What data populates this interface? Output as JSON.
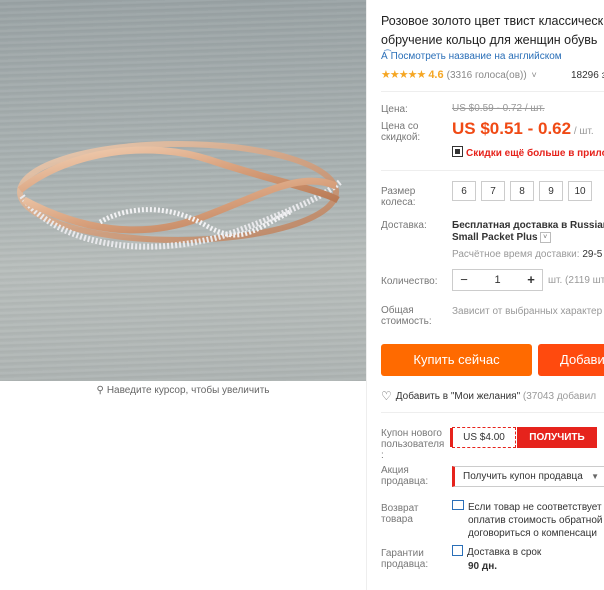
{
  "image": {
    "zoom_hint": "Наведите курсор, чтобы увеличить"
  },
  "product": {
    "title_line1": "Розовое золото цвет твист классическ",
    "title_line2": "обручение кольцо для женщин обувь",
    "translate_link": "Посмотреть название на английском",
    "stars": "★★★★★",
    "rating": "4.6",
    "votes": "(3316 голоса(ов))",
    "orders": "18296 з"
  },
  "price": {
    "label": "Цена:",
    "old": "US $0.59 - 0.72",
    "old_unit": " / шт.",
    "discount_label_1": "Цена со",
    "discount_label_2": "скидкой:",
    "sale": "US $0.51 - 0.62",
    "sale_unit": " / шт.",
    "app_discount": "Скидки ещё больше в прилож"
  },
  "size": {
    "label_1": "Размер",
    "label_2": "колеса:",
    "options": [
      "6",
      "7",
      "8",
      "9",
      "10"
    ]
  },
  "shipping": {
    "label": "Доставка:",
    "title": "Бесплатная доставка в Russian",
    "method": "Small Packet Plus",
    "time_label": "Расчётное время доставки:",
    "time_value": " 29-5"
  },
  "quantity": {
    "label": "Количество:",
    "minus": "−",
    "value": "1",
    "plus": "+",
    "stock": "шт. (2119 шт."
  },
  "total": {
    "label_1": "Общая",
    "label_2": "стоимость:",
    "value": "Зависит от выбранных характер"
  },
  "actions": {
    "buy_now": "Купить сейчас",
    "add_to_cart": "Добави",
    "wishlist": "Добавить в \"Мои желания\"",
    "wishlist_count": " (37043 добавил"
  },
  "coupons": {
    "new_user_label_1": "Купон нового",
    "new_user_label_2": "пользователя",
    "new_user_label_3": ":",
    "amount": "US $4.00",
    "get": "ПОЛУЧИТЬ",
    "seller_label_1": "Акция",
    "seller_label_2": "продавца:",
    "seller_select": "Получить купон продавца"
  },
  "returns": {
    "label_1": "Возврат",
    "label_2": "товара",
    "line1": "Если товар не соответствует",
    "line2": "оплатив стоимость обратной",
    "line3": "договориться о компенсаци"
  },
  "guarantee": {
    "label_1": "Гарантии",
    "label_2": "продавца:",
    "text": "Доставка в срок",
    "days": "90 дн."
  }
}
